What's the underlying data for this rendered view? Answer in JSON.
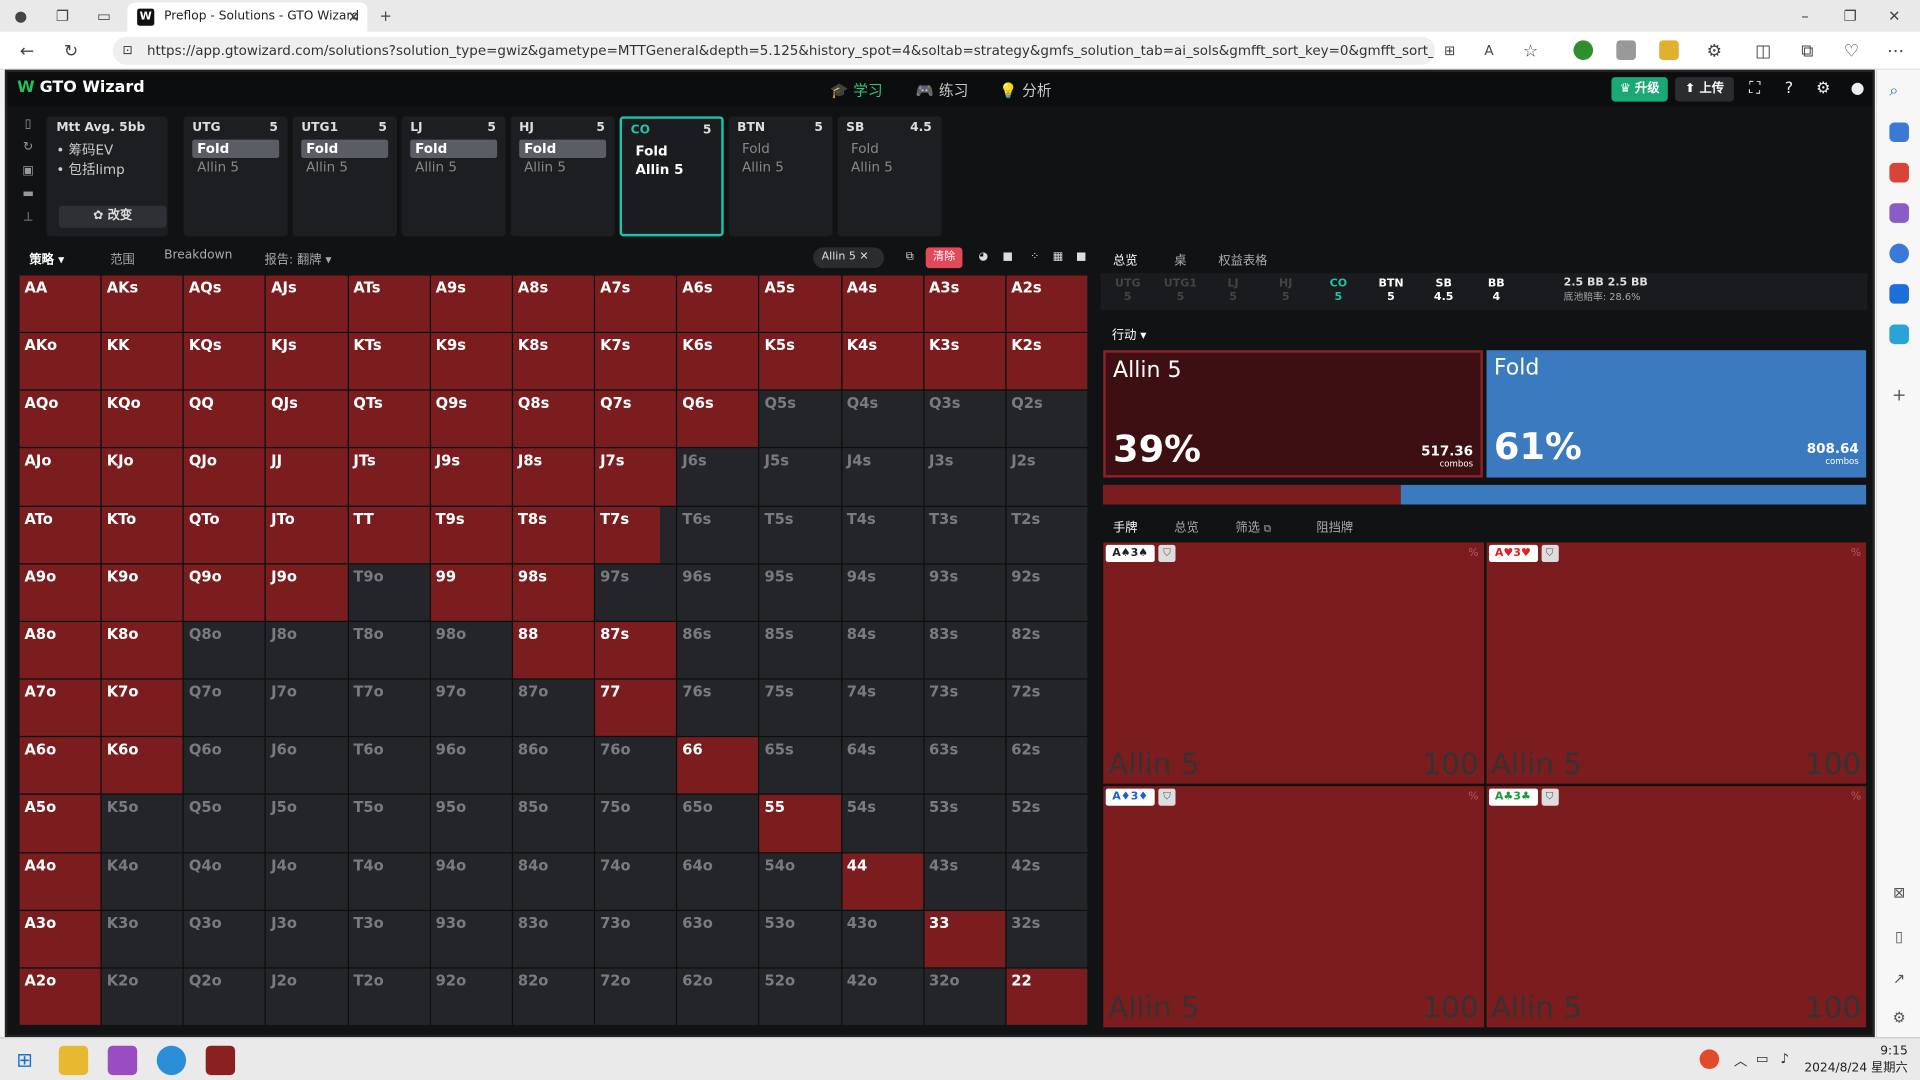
{
  "browser": {
    "tab_title": "Preflop - Solutions - GTO Wizard",
    "tab_icon": "W",
    "url": "https://app.gtowizard.com/solutions?solution_type=gwiz&gametype=MTTGeneral&depth=5.125&history_spot=4&soltab=strategy&gmfs_solution_tab=ai_sols&gmfft_sort_key=0&gmfft_sort_order=desc&..."
  },
  "app": {
    "logo": "GTO Wizard",
    "nav": [
      "学习",
      "练习",
      "分析"
    ],
    "upgrade_label": "升级",
    "upload_label": "上传"
  },
  "settings_card": {
    "title": "Mtt Avg. 5bb",
    "bullets": [
      "• 筹码EV",
      "• 包括limp"
    ],
    "change_label": "改变"
  },
  "positions": [
    {
      "pos": "UTG",
      "stack": "5",
      "actions": [
        "Fold",
        "Allin 5"
      ]
    },
    {
      "pos": "UTG1",
      "stack": "5",
      "actions": [
        "Fold",
        "Allin 5"
      ]
    },
    {
      "pos": "LJ",
      "stack": "5",
      "actions": [
        "Fold",
        "Allin 5"
      ]
    },
    {
      "pos": "HJ",
      "stack": "5",
      "actions": [
        "Fold",
        "Allin 5"
      ]
    },
    {
      "pos": "CO",
      "stack": "5",
      "actions": [
        "Fold",
        "Allin 5"
      ]
    },
    {
      "pos": "BTN",
      "stack": "5",
      "actions": [
        "Fold",
        "Allin 5"
      ]
    },
    {
      "pos": "SB",
      "stack": "4.5",
      "actions": [
        "Fold",
        "Allin 5"
      ]
    }
  ],
  "toolbar": {
    "tabs": [
      "策略",
      "范围",
      "Breakdown",
      "报告: 翻牌"
    ],
    "filter_chip": "Allin 5",
    "clear_label": "清除"
  },
  "grid": {
    "rows": [
      [
        "AA",
        "AKs",
        "AQs",
        "AJs",
        "ATs",
        "A9s",
        "A8s",
        "A7s",
        "A6s",
        "A5s",
        "A4s",
        "A3s",
        "A2s"
      ],
      [
        "AKo",
        "KK",
        "KQs",
        "KJs",
        "KTs",
        "K9s",
        "K8s",
        "K7s",
        "K6s",
        "K5s",
        "K4s",
        "K3s",
        "K2s"
      ],
      [
        "AQo",
        "KQo",
        "QQ",
        "QJs",
        "QTs",
        "Q9s",
        "Q8s",
        "Q7s",
        "Q6s",
        "Q5s",
        "Q4s",
        "Q3s",
        "Q2s"
      ],
      [
        "AJo",
        "KJo",
        "QJo",
        "JJ",
        "JTs",
        "J9s",
        "J8s",
        "J7s",
        "J6s",
        "J5s",
        "J4s",
        "J3s",
        "J2s"
      ],
      [
        "ATo",
        "KTo",
        "QTo",
        "JTo",
        "TT",
        "T9s",
        "T8s",
        "T7s",
        "T6s",
        "T5s",
        "T4s",
        "T3s",
        "T2s"
      ],
      [
        "A9o",
        "K9o",
        "Q9o",
        "J9o",
        "T9o",
        "99",
        "98s",
        "97s",
        "96s",
        "95s",
        "94s",
        "93s",
        "92s"
      ],
      [
        "A8o",
        "K8o",
        "Q8o",
        "J8o",
        "T8o",
        "98o",
        "88",
        "87s",
        "86s",
        "85s",
        "84s",
        "83s",
        "82s"
      ],
      [
        "A7o",
        "K7o",
        "Q7o",
        "J7o",
        "T7o",
        "97o",
        "87o",
        "77",
        "76s",
        "75s",
        "74s",
        "73s",
        "72s"
      ],
      [
        "A6o",
        "K6o",
        "Q6o",
        "J6o",
        "T6o",
        "96o",
        "86o",
        "76o",
        "66",
        "65s",
        "64s",
        "63s",
        "62s"
      ],
      [
        "A5o",
        "K5o",
        "Q5o",
        "J5o",
        "T5o",
        "95o",
        "85o",
        "75o",
        "65o",
        "55",
        "54s",
        "53s",
        "52s"
      ],
      [
        "A4o",
        "K4o",
        "Q4o",
        "J4o",
        "T4o",
        "94o",
        "84o",
        "74o",
        "64o",
        "54o",
        "44",
        "43s",
        "42s"
      ],
      [
        "A3o",
        "K3o",
        "Q3o",
        "J3o",
        "T3o",
        "93o",
        "83o",
        "73o",
        "63o",
        "53o",
        "43o",
        "33",
        "32s"
      ],
      [
        "A2o",
        "K2o",
        "Q2o",
        "J2o",
        "T2o",
        "92o",
        "82o",
        "72o",
        "62o",
        "52o",
        "42o",
        "32o",
        "22"
      ]
    ],
    "allin_freq": [
      [
        1,
        1,
        1,
        1,
        1,
        1,
        1,
        1,
        1,
        1,
        1,
        1,
        1
      ],
      [
        1,
        1,
        1,
        1,
        1,
        1,
        1,
        1,
        1,
        1,
        1,
        1,
        1
      ],
      [
        1,
        1,
        1,
        1,
        1,
        1,
        1,
        1,
        1,
        0,
        0,
        0,
        0
      ],
      [
        1,
        1,
        1,
        1,
        1,
        1,
        1,
        1,
        0,
        0,
        0,
        0,
        0
      ],
      [
        1,
        1,
        1,
        1,
        1,
        1,
        1,
        0.8,
        0,
        0,
        0,
        0,
        0
      ],
      [
        1,
        1,
        1,
        1,
        0,
        1,
        1,
        0,
        0,
        0,
        0,
        0,
        0
      ],
      [
        1,
        1,
        0,
        0,
        0,
        0,
        1,
        1,
        0,
        0,
        0,
        0,
        0
      ],
      [
        1,
        1,
        0,
        0,
        0,
        0,
        0,
        1,
        0,
        0,
        0,
        0,
        0
      ],
      [
        1,
        1,
        0,
        0,
        0,
        0,
        0,
        0,
        1,
        0,
        0,
        0,
        0
      ],
      [
        1,
        0,
        0,
        0,
        0,
        0,
        0,
        0,
        0,
        1,
        0,
        0,
        0
      ],
      [
        1,
        0,
        0,
        0,
        0,
        0,
        0,
        0,
        0,
        0,
        1,
        0,
        0
      ],
      [
        1,
        0,
        0,
        0,
        0,
        0,
        0,
        0,
        0,
        0,
        0,
        1,
        0
      ],
      [
        1,
        0,
        0,
        0,
        0,
        0,
        0,
        0,
        0,
        0,
        0,
        0,
        1
      ]
    ],
    "colors": {
      "allin": "#7b1c1f",
      "empty": "#242528"
    }
  },
  "right_panel": {
    "tabs": [
      "总览",
      "桌",
      "权益表格"
    ],
    "strip": [
      {
        "pos": "UTG",
        "stack": "5",
        "state": "folded"
      },
      {
        "pos": "UTG1",
        "stack": "5",
        "state": "folded"
      },
      {
        "pos": "LJ",
        "stack": "5",
        "state": "folded"
      },
      {
        "pos": "HJ",
        "stack": "5",
        "state": "folded"
      },
      {
        "pos": "CO",
        "stack": "5",
        "state": "me"
      },
      {
        "pos": "BTN",
        "stack": "5",
        "state": "live"
      },
      {
        "pos": "SB",
        "stack": "4.5",
        "state": "live"
      },
      {
        "pos": "BB",
        "stack": "4",
        "state": "live"
      }
    ],
    "pot_line1": "2.5 BB  2.5 BB",
    "pot_line2": "底池赔率:  28.6%",
    "action_dropdown": "行动",
    "actions": [
      {
        "name": "Allin 5",
        "pct": "39%",
        "combos": "517.36",
        "unit": "combos"
      },
      {
        "name": "Fold",
        "pct": "61%",
        "combos": "808.64",
        "unit": "combos"
      }
    ],
    "allin_share": 0.39,
    "hand_tabs": [
      "手牌",
      "总览",
      "筛选",
      "阻挡牌"
    ],
    "combos": [
      {
        "cards": "A♠3♠",
        "suit_color": "#222",
        "action": "Allin 5",
        "freq": "100",
        "pct_mark": "%"
      },
      {
        "cards": "A♥3♥",
        "suit_color": "#d22",
        "action": "Allin 5",
        "freq": "100",
        "pct_mark": "%"
      },
      {
        "cards": "A♦3♦",
        "suit_color": "#1c5fd8",
        "action": "Allin 5",
        "freq": "100",
        "pct_mark": "%"
      },
      {
        "cards": "A♣3♣",
        "suit_color": "#1c9a3c",
        "action": "Allin 5",
        "freq": "100",
        "pct_mark": "%"
      }
    ]
  },
  "taskbar": {
    "time": "9:15",
    "date": "2024/8/24 星期六"
  }
}
